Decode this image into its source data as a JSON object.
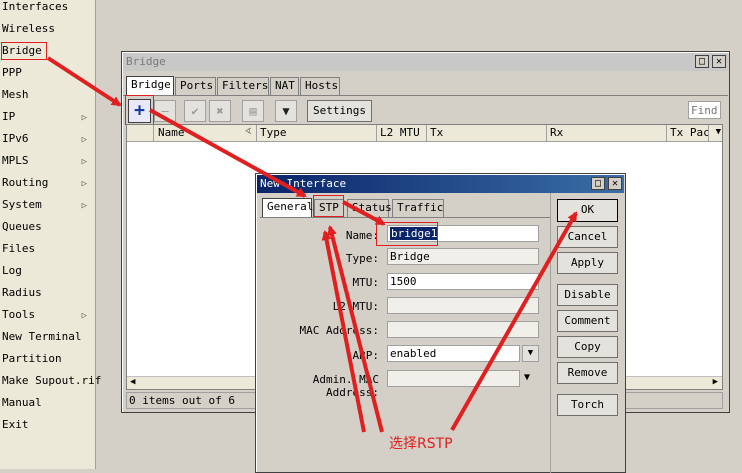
{
  "menu": {
    "items": [
      {
        "label": "Interfaces",
        "sub": false
      },
      {
        "label": "Wireless",
        "sub": false
      },
      {
        "label": "Bridge",
        "sub": false
      },
      {
        "label": "PPP",
        "sub": false
      },
      {
        "label": "Mesh",
        "sub": false
      },
      {
        "label": "IP",
        "sub": true
      },
      {
        "label": "IPv6",
        "sub": true
      },
      {
        "label": "MPLS",
        "sub": true
      },
      {
        "label": "Routing",
        "sub": true
      },
      {
        "label": "System",
        "sub": true
      },
      {
        "label": "Queues",
        "sub": false
      },
      {
        "label": "Files",
        "sub": false
      },
      {
        "label": "Log",
        "sub": false
      },
      {
        "label": "Radius",
        "sub": false
      },
      {
        "label": "Tools",
        "sub": true
      },
      {
        "label": "New Terminal",
        "sub": false
      },
      {
        "label": "Partition",
        "sub": false
      },
      {
        "label": "Make Supout.rif",
        "sub": false
      },
      {
        "label": "Manual",
        "sub": false
      },
      {
        "label": "Exit",
        "sub": false
      }
    ]
  },
  "bridge_window": {
    "title": "Bridge",
    "tabs": [
      "Bridge",
      "Ports",
      "Filters",
      "NAT",
      "Hosts"
    ],
    "settings_label": "Settings",
    "find_placeholder": "Find",
    "columns": [
      "Name",
      "Type",
      "L2 MTU",
      "Tx",
      "Rx",
      "Tx Pack"
    ],
    "status": "0 items out of 6"
  },
  "dialog": {
    "title": "New Interface",
    "tabs": [
      "General",
      "STP",
      "Status",
      "Traffic"
    ],
    "fields": {
      "name_label": "Name:",
      "name_value": "bridge1",
      "type_label": "Type:",
      "type_value": "Bridge",
      "mtu_label": "MTU:",
      "mtu_value": "1500",
      "l2mtu_label": "L2 MTU:",
      "l2mtu_value": "",
      "mac_label": "MAC Address:",
      "mac_value": "",
      "arp_label": "ARP:",
      "arp_value": "enabled",
      "admin_mac_label": "Admin. MAC Address:",
      "admin_mac_value": ""
    },
    "buttons": [
      "OK",
      "Cancel",
      "Apply",
      "Disable",
      "Comment",
      "Copy",
      "Remove",
      "Torch"
    ]
  },
  "annotation": {
    "text": "选择RSTP",
    "color": "#e02020"
  }
}
